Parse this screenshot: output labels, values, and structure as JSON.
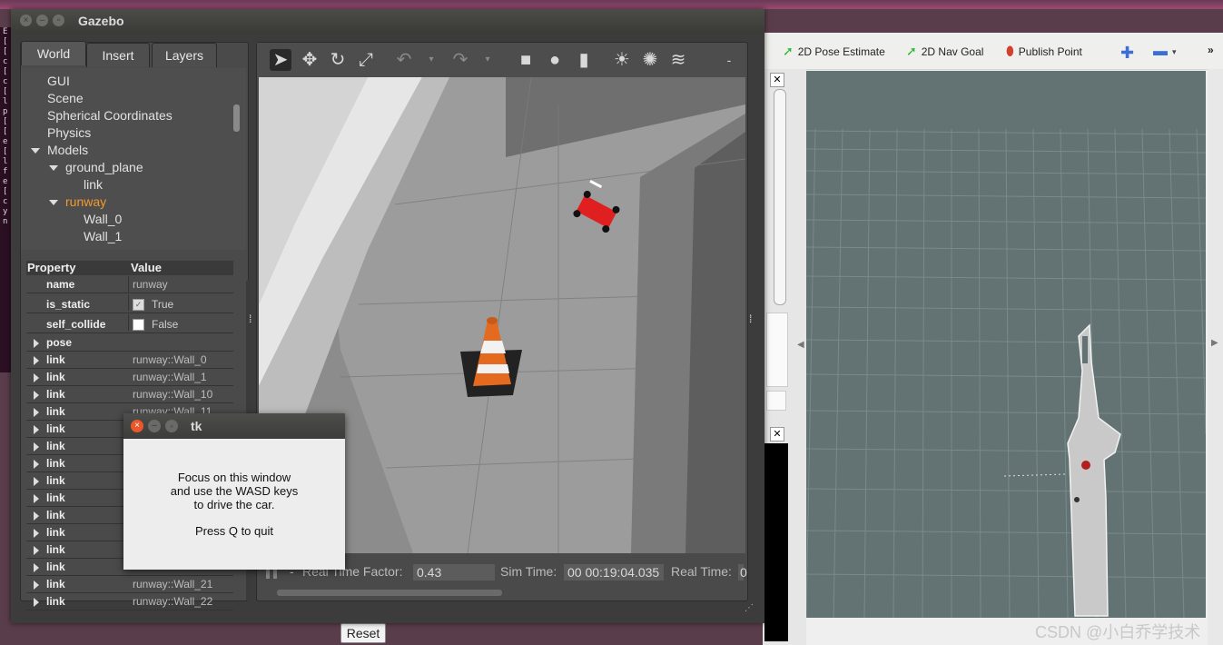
{
  "terminal": {
    "chars": [
      "E",
      "[",
      "[",
      "c",
      "[",
      "c",
      "[",
      "l",
      "p",
      "[",
      "[",
      "e",
      "[",
      "l",
      "f",
      "e",
      "[",
      "c",
      "y",
      "n"
    ]
  },
  "rviz": {
    "tools": [
      {
        "label": "2D Pose Estimate",
        "icon": "green-arrow-icon"
      },
      {
        "label": "2D Nav Goal",
        "icon": "green-arrow-icon"
      },
      {
        "label": "Publish Point",
        "icon": "map-pin-icon"
      }
    ],
    "more": "»",
    "reset_label": "Reset",
    "map_background": "#637272"
  },
  "gazebo": {
    "title": "Gazebo",
    "tabs": [
      {
        "label": "World",
        "active": true
      },
      {
        "label": "Insert",
        "active": false
      },
      {
        "label": "Layers",
        "active": false
      }
    ],
    "tree": {
      "gui": "GUI",
      "scene": "Scene",
      "spherical": "Spherical Coordinates",
      "physics": "Physics",
      "models": "Models",
      "ground_plane": "ground_plane",
      "link": "link",
      "runway": "runway",
      "wall0": "Wall_0",
      "wall1": "Wall_1"
    },
    "props": {
      "header_property": "Property",
      "header_value": "Value",
      "name_key": "name",
      "name_val": "runway",
      "static_key": "is_static",
      "static_val": "True",
      "collide_key": "self_collide",
      "collide_val": "False",
      "pose": "pose",
      "link_key": "link",
      "links": [
        "runway::Wall_0",
        "runway::Wall_1",
        "runway::Wall_10",
        "runway::Wall_11",
        "",
        "",
        "",
        "",
        "",
        "",
        "",
        "",
        "",
        "runway::Wall_21",
        "runway::Wall_22"
      ]
    },
    "bottom": {
      "rtf_label": "Real Time Factor:",
      "rtf_value": "0.43",
      "sim_label": "Sim Time:",
      "sim_value": "00 00:19:04.035",
      "real_label": "Real Time:",
      "real_value": "0"
    },
    "toolbar_dash": "-"
  },
  "tk": {
    "title": "tk",
    "line1": "Focus on this window",
    "line2": "and use the WASD keys",
    "line3": "to drive the car.",
    "line4": "Press Q to quit"
  },
  "watermark": "CSDN @小白乔学技术",
  "colors": {
    "selected": "#f39a2f",
    "car": "#e02020",
    "rviz_map": "#637272"
  }
}
